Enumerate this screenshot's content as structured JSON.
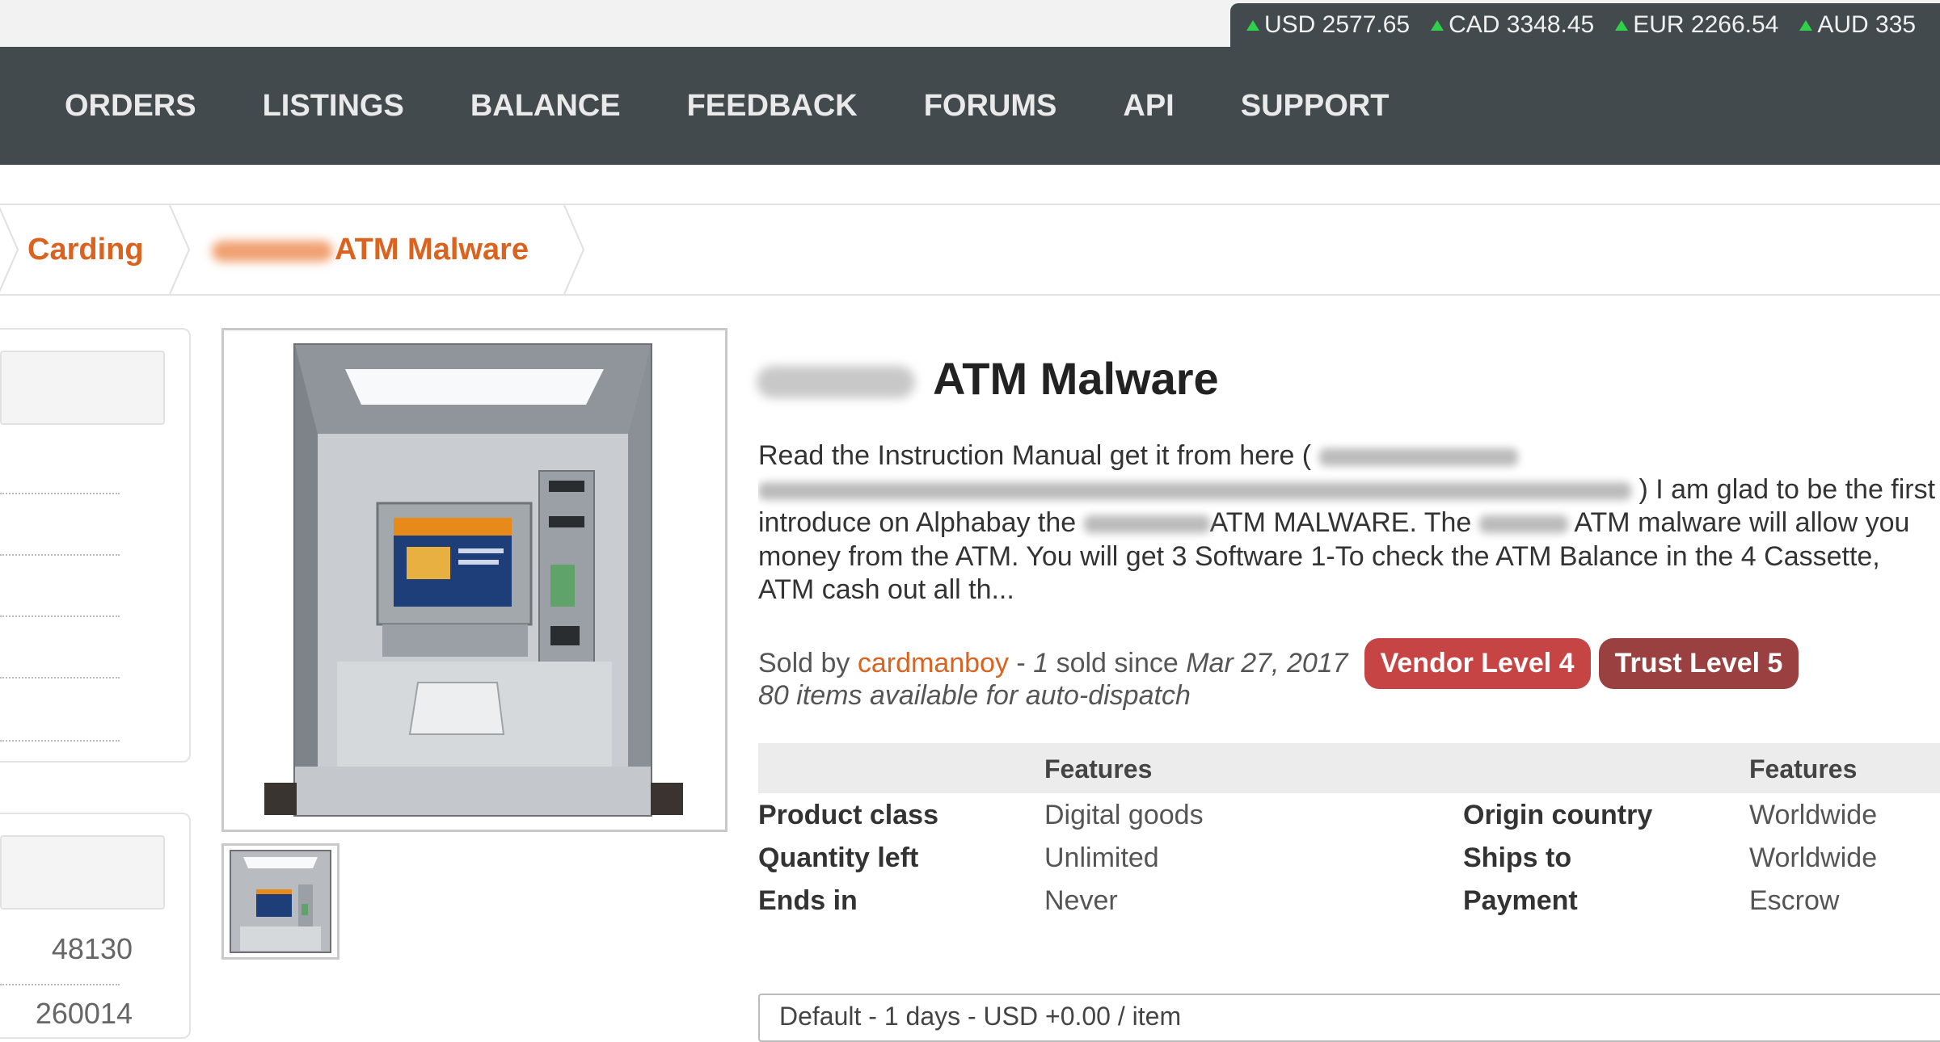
{
  "currency": {
    "rates": [
      {
        "text": "USD 2577.65"
      },
      {
        "text": "CAD 3348.45"
      },
      {
        "text": "EUR 2266.54"
      },
      {
        "text": "AUD 335"
      }
    ],
    "up_color": "#2fd04a"
  },
  "nav": {
    "items": [
      "ORDERS",
      "LISTINGS",
      "BALANCE",
      "FEEDBACK",
      "FORUMS",
      "API",
      "SUPPORT"
    ]
  },
  "breadcrumb": {
    "category": "Carding",
    "current": "ATM Malware"
  },
  "sidebar": {
    "numbers": [
      "48130",
      "260014"
    ]
  },
  "listing": {
    "title": "ATM Malware",
    "description": {
      "p1": "Read the Instruction Manual get it from here (",
      "p2": ") I am glad to be the first",
      "p3": "introduce on Alphabay the",
      "p4": "ATM MALWARE. The",
      "p5": "ATM malware will allow you",
      "p6": "money from the ATM. You will get 3 Software 1-To check the ATM Balance in the 4 Cassette,",
      "p7": "ATM cash out all th..."
    },
    "sold_by_label": "Sold by",
    "vendor": "cardmanboy",
    "sold_dash": "-",
    "sold_count": "1",
    "sold_since_label": "sold since",
    "sold_date": "Mar 27, 2017",
    "badges": {
      "vendor_level": "Vendor Level 4",
      "trust_level": "Trust Level 5"
    },
    "availability": "80 items available for auto-dispatch",
    "features": {
      "header": "Features",
      "left": [
        {
          "label": "Product class",
          "value": "Digital goods"
        },
        {
          "label": "Quantity left",
          "value": "Unlimited"
        },
        {
          "label": "Ends in",
          "value": "Never"
        }
      ],
      "right": [
        {
          "label": "Origin country",
          "value": "Worldwide"
        },
        {
          "label": "Ships to",
          "value": "Worldwide"
        },
        {
          "label": "Payment",
          "value": "Escrow"
        }
      ]
    },
    "shipping_option": "Default - 1 days - USD +0.00 / item"
  },
  "colors": {
    "accent": "#d9631f",
    "navbar": "#424a4d",
    "vendor_badge": "#c74444",
    "trust_badge": "#9a4040"
  }
}
